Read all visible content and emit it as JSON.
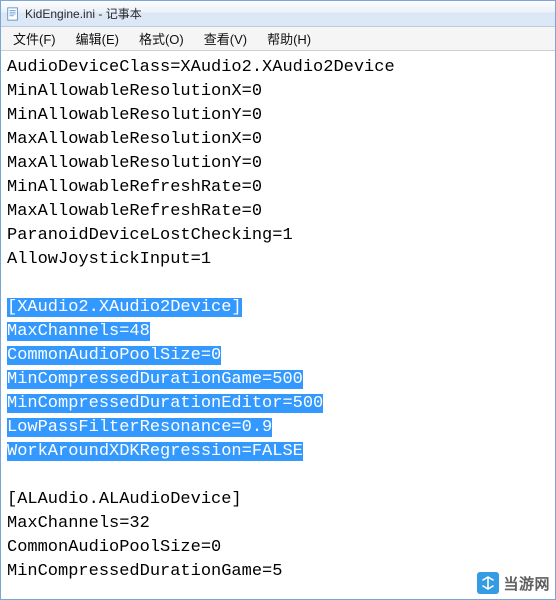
{
  "window": {
    "title": "KidEngine.ini - 记事本",
    "icon_name": "notepad-icon"
  },
  "menubar": {
    "items": [
      {
        "label": "文件(F)"
      },
      {
        "label": "编辑(E)"
      },
      {
        "label": "格式(O)"
      },
      {
        "label": "查看(V)"
      },
      {
        "label": "帮助(H)"
      }
    ]
  },
  "editor": {
    "lines": [
      {
        "text": "AudioDeviceClass=XAudio2.XAudio2Device",
        "selected": false
      },
      {
        "text": "MinAllowableResolutionX=0",
        "selected": false
      },
      {
        "text": "MinAllowableResolutionY=0",
        "selected": false
      },
      {
        "text": "MaxAllowableResolutionX=0",
        "selected": false
      },
      {
        "text": "MaxAllowableResolutionY=0",
        "selected": false
      },
      {
        "text": "MinAllowableRefreshRate=0",
        "selected": false
      },
      {
        "text": "MaxAllowableRefreshRate=0",
        "selected": false
      },
      {
        "text": "ParanoidDeviceLostChecking=1",
        "selected": false
      },
      {
        "text": "AllowJoystickInput=1",
        "selected": false
      },
      {
        "text": "",
        "selected": false
      },
      {
        "text": "[XAudio2.XAudio2Device]",
        "selected": true
      },
      {
        "text": "MaxChannels=48",
        "selected": true
      },
      {
        "text": "CommonAudioPoolSize=0",
        "selected": true
      },
      {
        "text": "MinCompressedDurationGame=500",
        "selected": true
      },
      {
        "text": "MinCompressedDurationEditor=500",
        "selected": true
      },
      {
        "text": "LowPassFilterResonance=0.9",
        "selected": true
      },
      {
        "text": "WorkAroundXDKRegression=FALSE",
        "selected": true
      },
      {
        "text": "",
        "selected": false
      },
      {
        "text": "[ALAudio.ALAudioDevice]",
        "selected": false
      },
      {
        "text": "MaxChannels=32",
        "selected": false
      },
      {
        "text": "CommonAudioPoolSize=0",
        "selected": false
      },
      {
        "text": "MinCompressedDurationGame=5",
        "selected": false
      }
    ]
  },
  "watermark": {
    "text": "当游网"
  }
}
